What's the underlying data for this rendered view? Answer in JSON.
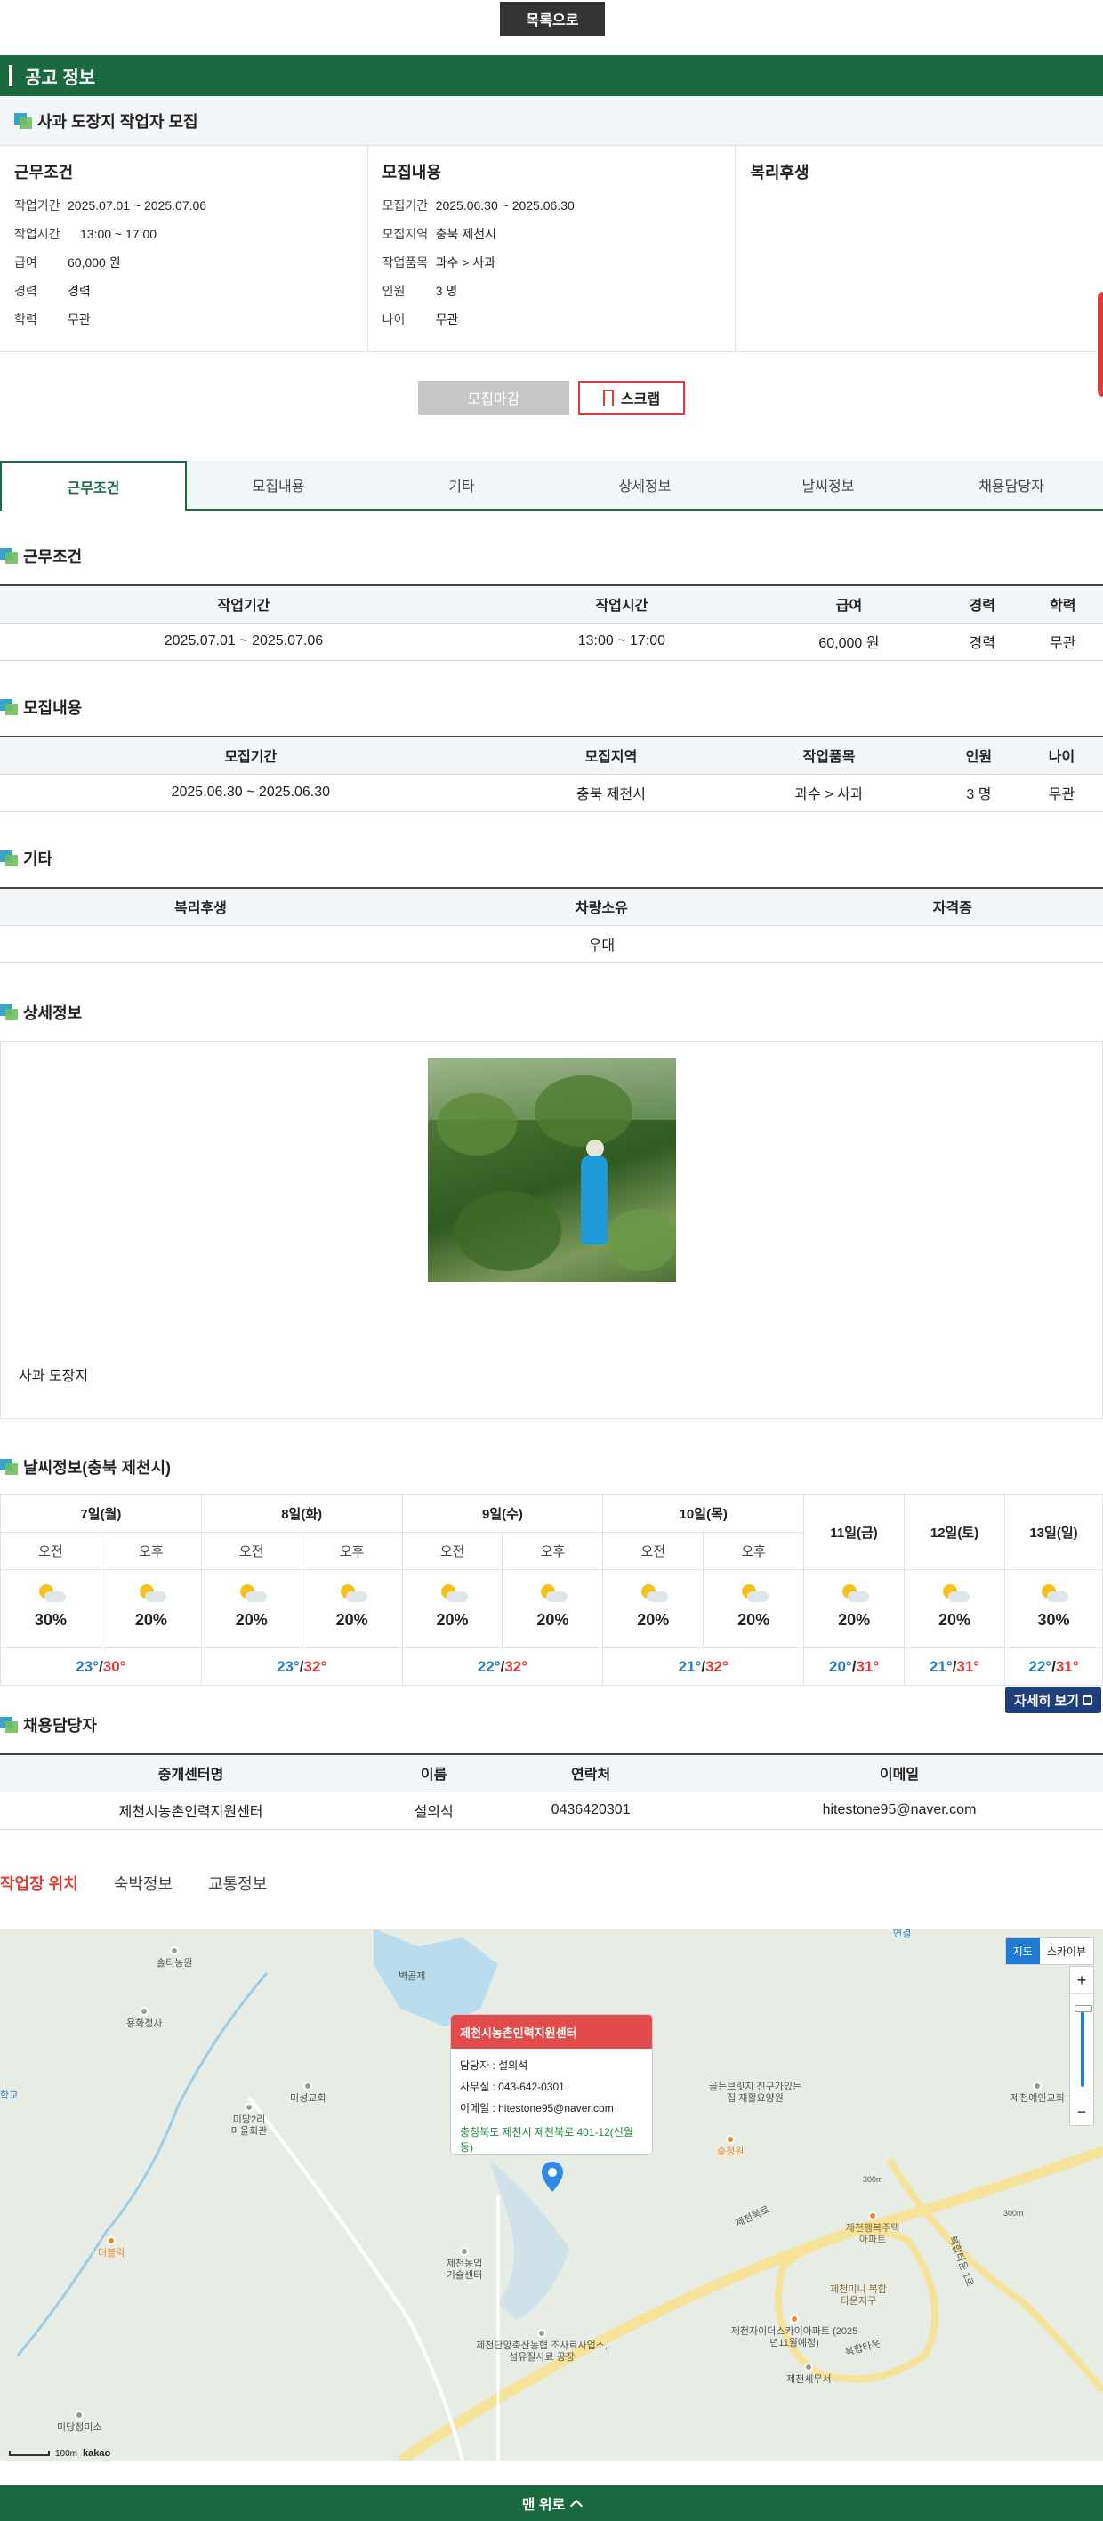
{
  "top": {
    "list_label": "목록으로"
  },
  "header": {
    "title": "공고 정보"
  },
  "job": {
    "title": "사과 도장지 작업자 모집"
  },
  "summary": {
    "work": {
      "heading": "근무조건",
      "items": [
        {
          "k": "작업기간",
          "v": "2025.07.01 ~ 2025.07.06"
        },
        {
          "k": "작업시간",
          "v": "13:00 ~ 17:00"
        },
        {
          "k": "급여",
          "v": "60,000 원"
        },
        {
          "k": "경력",
          "v": "경력"
        },
        {
          "k": "학력",
          "v": "무관"
        }
      ]
    },
    "recruit": {
      "heading": "모집내용",
      "items": [
        {
          "k": "모집기간",
          "v": "2025.06.30 ~ 2025.06.30"
        },
        {
          "k": "모집지역",
          "v": "충북 제천시"
        },
        {
          "k": "작업품목",
          "v": "과수 > 사과"
        },
        {
          "k": "인원",
          "v": "3 명"
        },
        {
          "k": "나이",
          "v": "무관"
        }
      ]
    },
    "welfare": {
      "heading": "복리후생"
    }
  },
  "actions": {
    "closed_label": "모집마감",
    "scrap_label": "스크랩"
  },
  "tabs": [
    "근무조건",
    "모집내용",
    "기타",
    "상세정보",
    "날씨정보",
    "채용담당자"
  ],
  "work_table": {
    "title": "근무조건",
    "headers": [
      "작업기간",
      "작업시간",
      "급여",
      "경력",
      "학력"
    ],
    "row": [
      "2025.07.01 ~ 2025.07.06",
      "13:00 ~ 17:00",
      "60,000 원",
      "경력",
      "무관"
    ]
  },
  "recruit_table": {
    "title": "모집내용",
    "headers": [
      "모집기간",
      "모집지역",
      "작업품목",
      "인원",
      "나이"
    ],
    "row": [
      "2025.06.30 ~ 2025.06.30",
      "충북 제천시",
      "과수 > 사과",
      "3 명",
      "무관"
    ]
  },
  "etc_table": {
    "title": "기타",
    "headers": [
      "복리후생",
      "차량소유",
      "자격증"
    ],
    "row": [
      "",
      "우대",
      ""
    ]
  },
  "detail": {
    "title": "상세정보",
    "text": "사과 도장지"
  },
  "weather": {
    "title": "날씨정보(충북 제천시)",
    "days": [
      "7일(월)",
      "8일(화)",
      "9일(수)",
      "10일(목)",
      "11일(금)",
      "12일(토)",
      "13일(일)"
    ],
    "am": "오전",
    "pm": "오후",
    "pops": [
      "30%",
      "20%",
      "20%",
      "20%",
      "20%",
      "20%",
      "20%",
      "20%",
      "20%",
      "20%",
      "30%"
    ],
    "temps": [
      {
        "lo": "23°",
        "hi": "30°"
      },
      {
        "lo": "23°",
        "hi": "32°"
      },
      {
        "lo": "22°",
        "hi": "32°"
      },
      {
        "lo": "21°",
        "hi": "32°"
      },
      {
        "lo": "20°",
        "hi": "31°"
      },
      {
        "lo": "21°",
        "hi": "31°"
      },
      {
        "lo": "22°",
        "hi": "31°"
      }
    ],
    "slash": "/",
    "more_label": "자세히 보기"
  },
  "manager": {
    "title": "채용담당자",
    "headers": [
      "중개센터명",
      "이름",
      "연락처",
      "이메일"
    ],
    "row": [
      "제천시농촌인력지원센터",
      "설의석",
      "0436420301",
      "hitestone95@naver.com"
    ]
  },
  "location_tabs": [
    "작업장 위치",
    "숙박정보",
    "교통정보"
  ],
  "map": {
    "toggle": [
      "지도",
      "스카이뷰"
    ],
    "zoom_in": "+",
    "zoom_out": "−",
    "popup": {
      "title": "제천시농촌인력지원센터",
      "manager": "담당자 : 설의석",
      "office": "사무실 : 043-642-0301",
      "email": "이메일 : hitestone95@naver.com",
      "address": "충청북도 제천시 제천북로 401-12(신월동)"
    },
    "labels": {
      "l1": "솔티농원",
      "l2": "용화정사",
      "l3": "미성교회",
      "l4": "미당2리 마을회관",
      "l5": "더블럭",
      "l6": "미당정미소",
      "l7": "제천농업 기술센터",
      "l8": "제천단양축산농협 조사료사업소,섬유질사료 공장",
      "l9": "골든브릿지 진구가있는 집 재활요양원",
      "l10": "숲정원",
      "l11": "제천행복주택 아파트",
      "l12": "제천미니 복합타운지구",
      "l13": "제천자이더스카이아파트 (2025년11월예정)",
      "l14": "제천세무서",
      "l15": "제천예인교회",
      "l16": "벽골제",
      "l17": "제천북로",
      "l18": "복합타운 1로",
      "l19": "복합타운",
      "l20": "300m",
      "l21": "300m",
      "l22": "학교",
      "l23": "연결"
    },
    "scale": "100m",
    "brand": "kakao"
  },
  "bottom": {
    "label": "맨 위로"
  }
}
